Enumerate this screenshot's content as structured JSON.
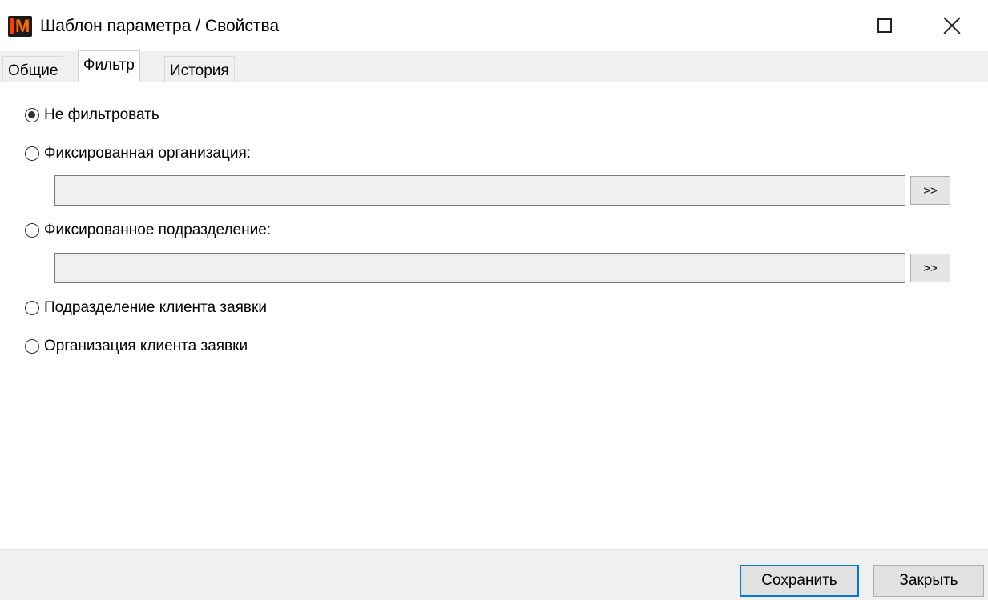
{
  "window": {
    "title": "Шаблон параметра / Свойства",
    "icon": "app-logo-icon",
    "icon_letters": "M"
  },
  "tabs": [
    {
      "label": "Общие",
      "active": false
    },
    {
      "label": "Фильтр",
      "active": true
    },
    {
      "label": "История",
      "active": false
    }
  ],
  "filter": {
    "options": [
      {
        "label": "Не фильтровать",
        "checked": true
      },
      {
        "label": "Фиксированная организация:",
        "checked": false
      },
      {
        "label": "Фиксированное подразделение:",
        "checked": false
      },
      {
        "label": "Подразделение клиента заявки",
        "checked": false
      },
      {
        "label": "Организация клиента заявки",
        "checked": false
      }
    ],
    "organization_value": "",
    "department_value": "",
    "browse_label": ">>"
  },
  "footer": {
    "save_label": "Сохранить",
    "close_label": "Закрыть"
  },
  "colors": {
    "accent": "#0078d7",
    "panel": "#f0f0f0",
    "logo_bg": "#1a1a1a",
    "logo_fg": "#ff6a00"
  }
}
